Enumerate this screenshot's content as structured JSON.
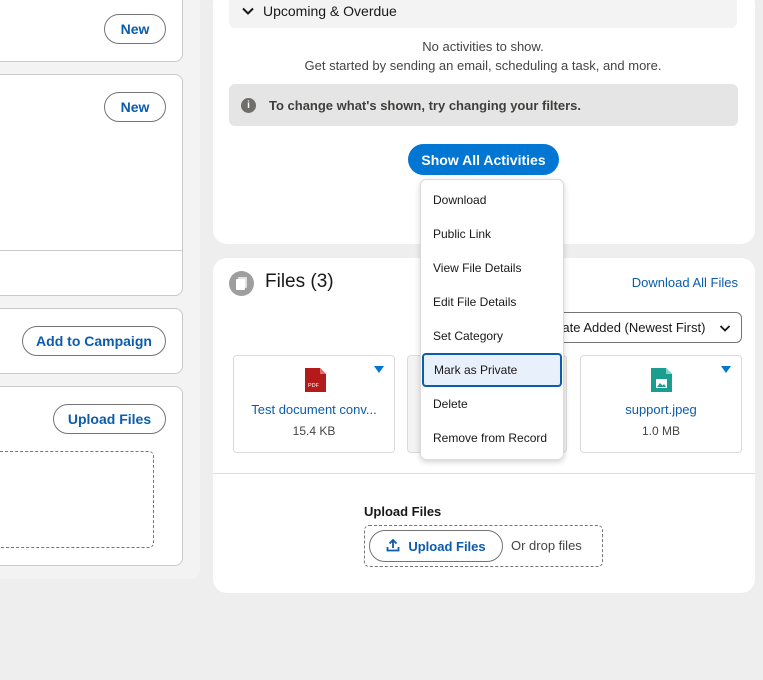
{
  "left": {
    "new_label_1": "New",
    "new_label_2": "New",
    "add_to_campaign": "Add to Campaign",
    "upload_files": "Upload Files"
  },
  "activity": {
    "section_title": "Upcoming & Overdue",
    "no_activities": "No activities to show.",
    "get_started": "Get started by sending an email, scheduling a task, and more.",
    "filter_hint": "To change what's shown, try changing your filters.",
    "show_all_button": "Show All Activities"
  },
  "files": {
    "title": "Files (3)",
    "download_all": "Download All Files",
    "sort_value": "Date Added (Newest First)",
    "tiles": [
      {
        "name": "Test document conv...",
        "size": "15.4 KB",
        "badge": "PDF",
        "color": "#b41a1a"
      },
      {
        "name": "",
        "size": "",
        "badge": "",
        "color": "#dddbda"
      },
      {
        "name": "support.jpeg",
        "size": "1.0 MB",
        "badge": "",
        "color": "#1b9e8f"
      }
    ],
    "upload_label": "Upload Files",
    "upload_button": "Upload Files",
    "drop_text": "Or drop files"
  },
  "menu": {
    "items": [
      {
        "label": "Download"
      },
      {
        "label": "Public Link"
      },
      {
        "label": "View File Details"
      },
      {
        "label": "Edit File Details"
      },
      {
        "label": "Set Category"
      },
      {
        "label": "Mark as Private"
      },
      {
        "label": "Delete"
      },
      {
        "label": "Remove from Record"
      }
    ],
    "active_index": 5
  },
  "colors": {
    "brand": "#0176d3",
    "link": "#0b5cab",
    "pdf_red": "#b41a1a",
    "image_teal": "#1b9e8f"
  }
}
